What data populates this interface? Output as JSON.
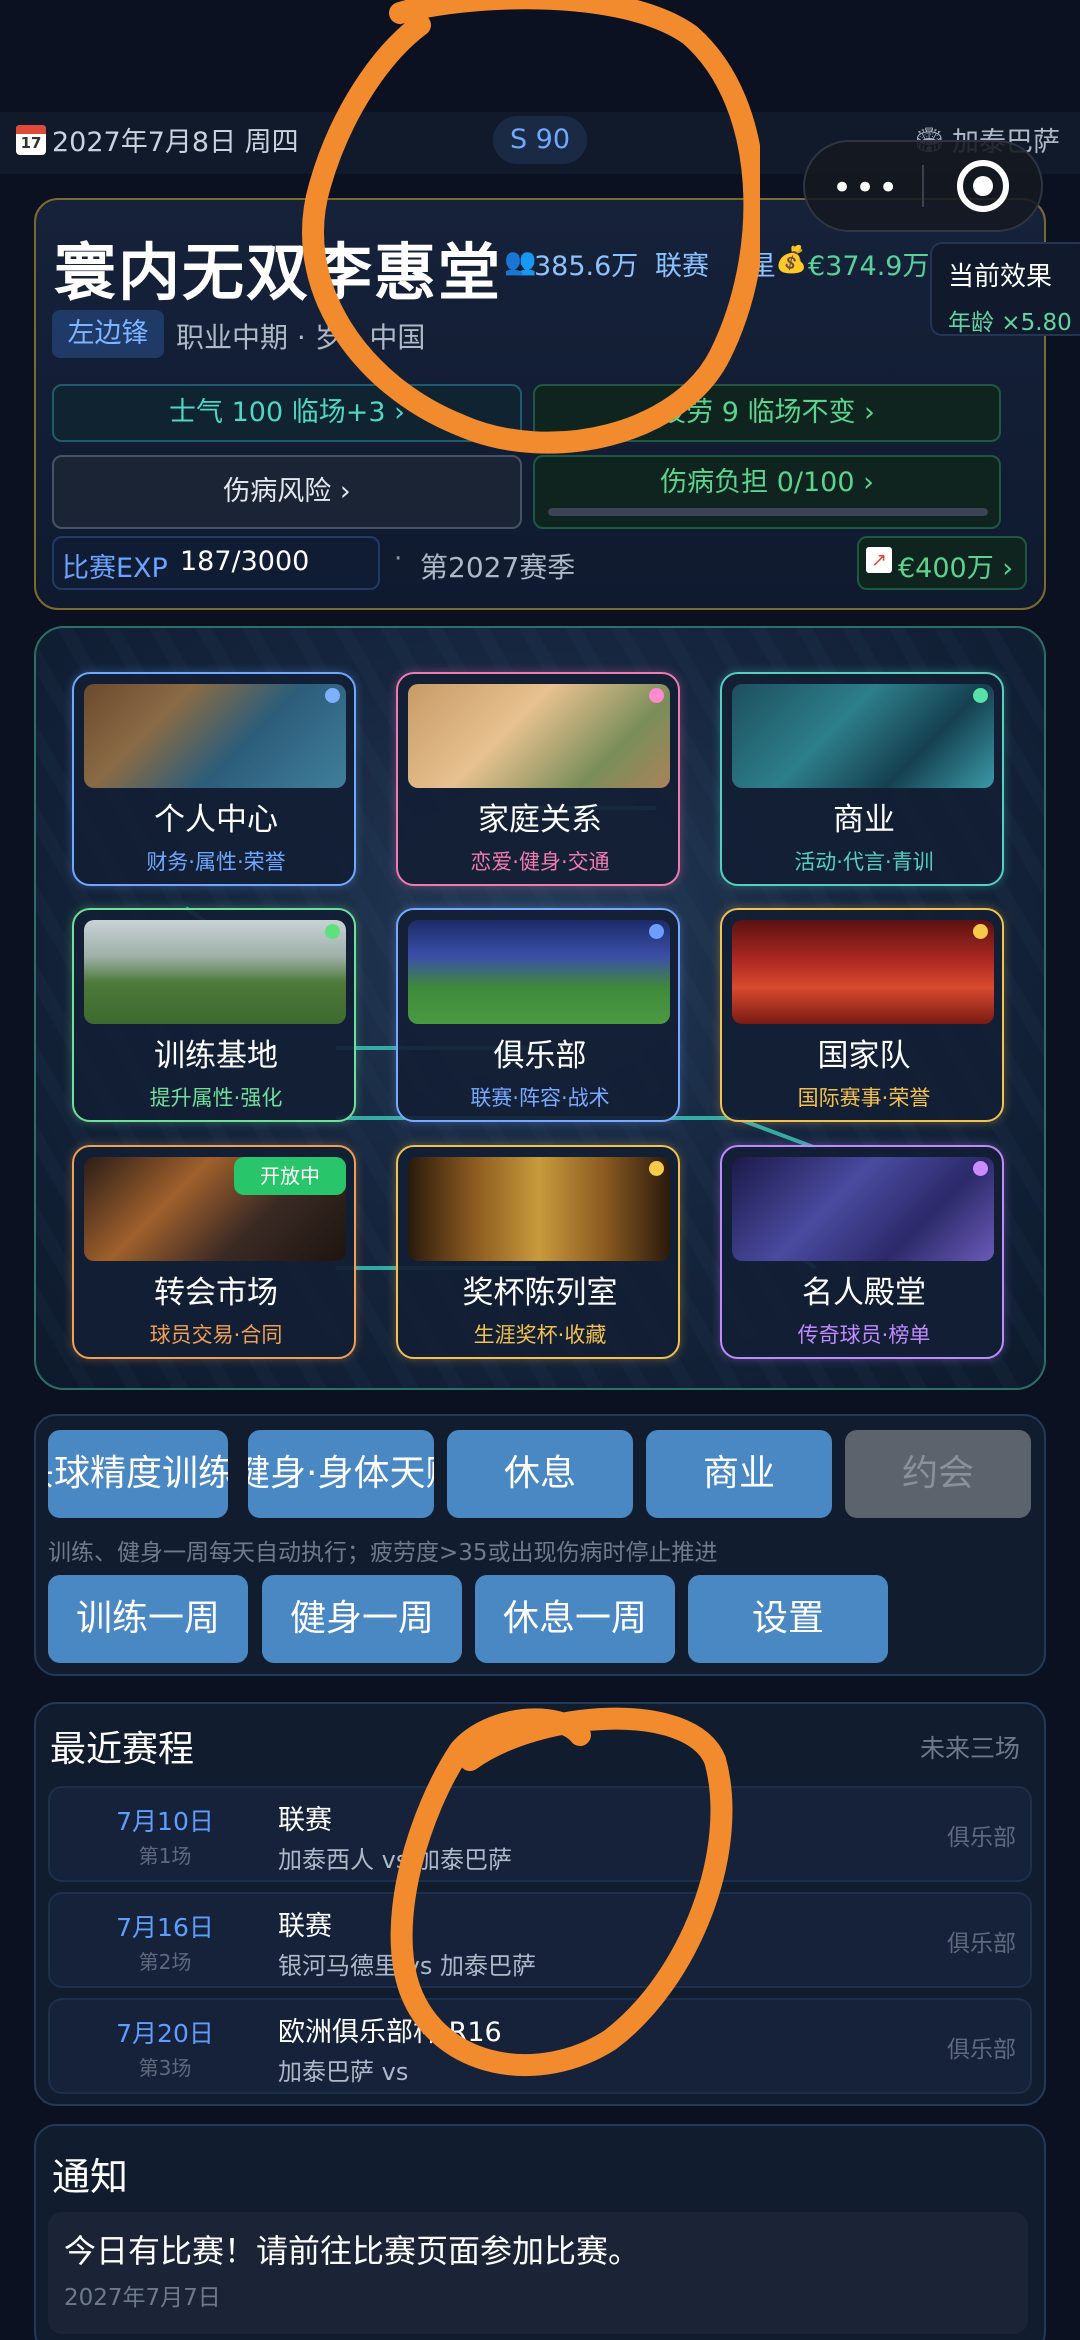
{
  "status": {
    "date": "2027年7月8日 周四",
    "calendar_day": "17",
    "season_pill": "S 90",
    "club": "加泰巴萨"
  },
  "player": {
    "name": "寰内无双李惠堂",
    "fans": "385.6万",
    "league_label": "联赛",
    "league_suffix": "星",
    "money": "€374.9万",
    "effect_title": "当前效果",
    "effect_text": "年龄 ×5.80",
    "position": "左边锋",
    "career": "职业中期 · 岁 · 中国",
    "morale": "士气 100  临场+3 ›",
    "fatigue": "疲劳 9  临场不变 ›",
    "injury_risk": "伤病风险 ›",
    "injury_load": "伤病负担 0/100 ›",
    "injury_load_ratio": 0.0,
    "exp_label": "比赛EXP",
    "exp_value": "187/3000",
    "season": "第2027赛季",
    "market_value": "€400万 ›"
  },
  "tiles": [
    {
      "title": "个人中心",
      "sub": "财务·属性·荣誉",
      "color": "#6fa8ff",
      "dot": "#7fb0ff",
      "img": "linear-gradient(135deg,#6b4a2e 0%,#8a6b45 30%,#2c5d7a 60%,#3f7f9c 100%)"
    },
    {
      "title": "家庭关系",
      "sub": "恋爱·健身·交通",
      "color": "#f07bb0",
      "dot": "#ff8ad1",
      "img": "linear-gradient(135deg,#c79b68 0%,#e7c18f 40%,#7a8e5a 75%,#a9835a 100%)"
    },
    {
      "title": "商业",
      "sub": "活动·代言·青训",
      "color": "#55d0c0",
      "dot": "#57e0a8",
      "img": "linear-gradient(135deg,#1d4f5e 0%,#2d7f8b 40%,#164050 70%,#3a9aa8 100%)"
    },
    {
      "title": "训练基地",
      "sub": "提升属性·强化",
      "color": "#6fe09a",
      "dot": "#5fe07e",
      "img": "linear-gradient(180deg,#c9d2d6 0%,#9fb0a8 35%,#4d7a3a 60%,#3d6a2e 100%)"
    },
    {
      "title": "俱乐部",
      "sub": "联赛·阵容·战术",
      "color": "#7aa8ff",
      "dot": "#6f9dff",
      "img": "linear-gradient(180deg,#1d2a6a 0%,#3b4fa8 35%,#3f8a3a 65%,#4a9a42 100%)"
    },
    {
      "title": "国家队",
      "sub": "国际赛事·荣誉",
      "color": "#f2c14e",
      "dot": "#f7c948",
      "img": "linear-gradient(180deg,#5a1212 0%,#b02a22 40%,#d84a2e 65%,#7a1a14 100%)"
    },
    {
      "title": "转会市场",
      "sub": "球员交易·合同",
      "color": "#f0a054",
      "dot": "",
      "img": "linear-gradient(135deg,#2b1d18 0%,#a0602c 35%,#3a2a24 65%,#1d1410 100%)",
      "badge": "开放中"
    },
    {
      "title": "奖杯陈列室",
      "sub": "生涯奖杯·收藏",
      "color": "#f2c14e",
      "dot": "#f7c948",
      "img": "linear-gradient(90deg,#2a1a0c 0%,#8a5a20 25%,#c89a3c 50%,#8a5a20 75%,#2a1a0c 100%)"
    },
    {
      "title": "名人殿堂",
      "sub": "传奇球员·榜单",
      "color": "#c08aff",
      "dot": "#c88cff",
      "img": "linear-gradient(135deg,#1c1a4a 0%,#4a4aa0 40%,#2c2a6a 70%,#6a5ab8 100%)"
    }
  ],
  "actions": {
    "row1": [
      "头球精度训练",
      "健身·身体天赋",
      "休息",
      "商业",
      "约会"
    ],
    "hint": "训练、健身一周每天自动执行；疲劳度>35或出现伤病时停止推进",
    "row2": [
      "训练一周",
      "健身一周",
      "休息一周",
      "设置"
    ]
  },
  "schedule": {
    "title": "最近赛程",
    "note": "未来三场",
    "matches": [
      {
        "date": "7月10日",
        "round": "第1场",
        "comp": "联赛",
        "teams": "加泰西人   vs   加泰巴萨",
        "tag": "俱乐部"
      },
      {
        "date": "7月16日",
        "round": "第2场",
        "comp": "联赛",
        "teams": "银河马德里   vs   加泰巴萨",
        "tag": "俱乐部"
      },
      {
        "date": "7月20日",
        "round": "第3场",
        "comp": "欧洲俱乐部杯·R16",
        "teams": "加泰巴萨   vs",
        "tag": "俱乐部"
      }
    ]
  },
  "notice": {
    "title": "通知",
    "text": "今日有比赛！请前往比赛页面参加比赛。",
    "date": "2027年7月7日"
  },
  "annotation_color": "#f28a2e"
}
